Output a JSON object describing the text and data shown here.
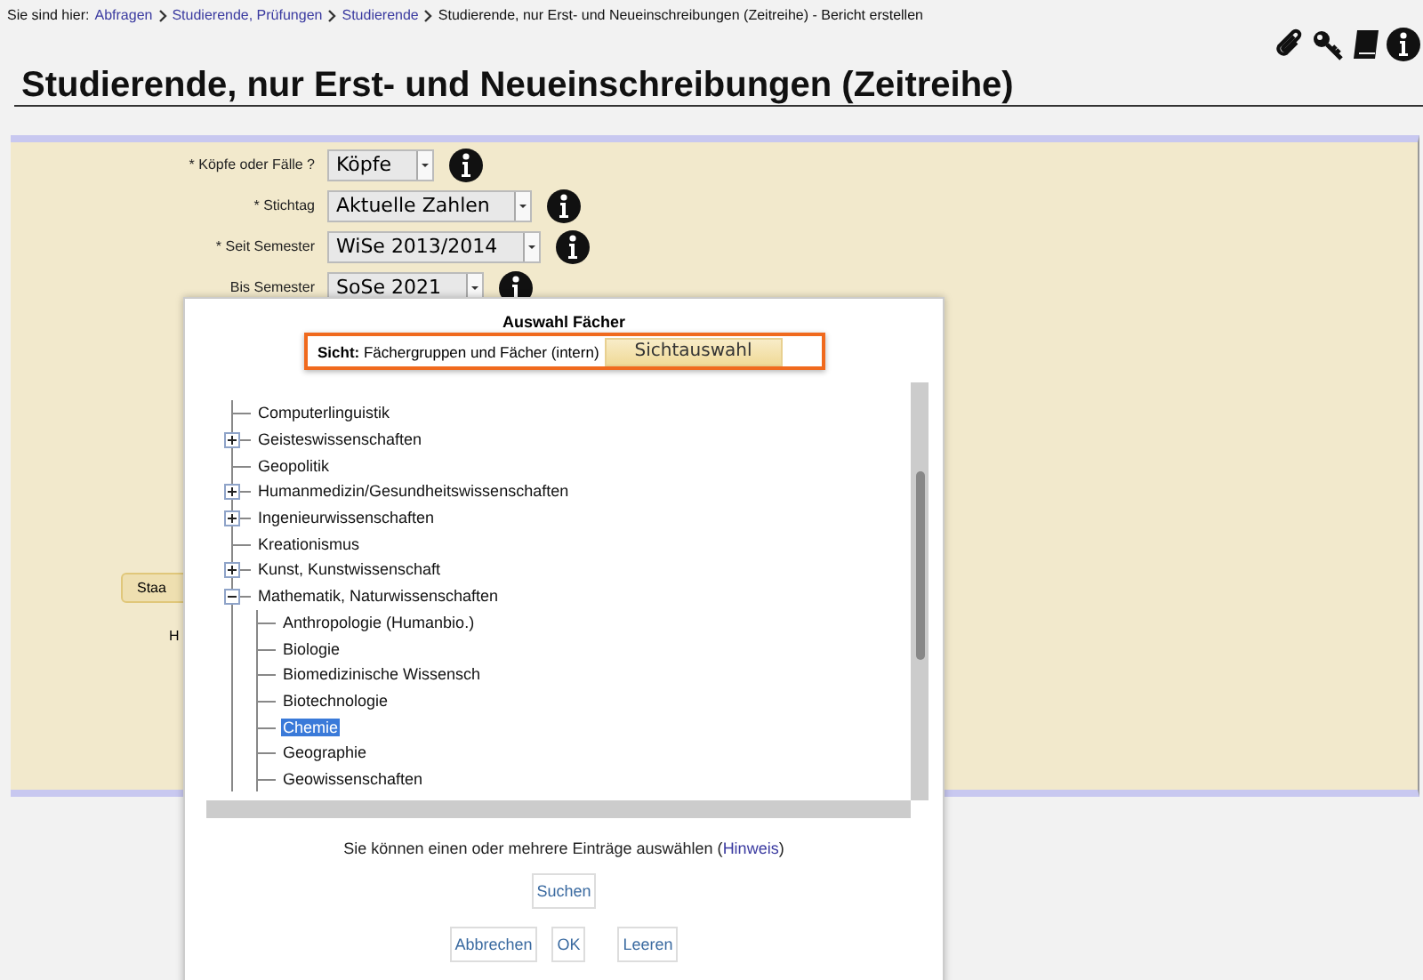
{
  "breadcrumb": {
    "prefix": "Sie sind hier:",
    "links": [
      "Abfragen",
      "Studierende, Prüfungen",
      "Studierende"
    ],
    "current": "Studierende, nur Erst- und Neueinschreibungen (Zeitreihe) - Bericht erstellen"
  },
  "title": "Studierende, nur Erst- und Neueinschreibungen (Zeitreihe)",
  "form": {
    "fields": [
      {
        "label": "* Köpfe oder Fälle ?",
        "value": "Köpfe"
      },
      {
        "label": "* Stichtag",
        "value": "Aktuelle Zahlen"
      },
      {
        "label": "* Seit Semester",
        "value": "WiSe 2013/2014"
      },
      {
        "label": "Bis Semester",
        "value": "SoSe 2021"
      }
    ],
    "button": "Staa",
    "hint": "H"
  },
  "dialog": {
    "title": "Auswahl Fächer",
    "view_label": "Sicht:",
    "view_value": "Fächergruppen und Fächer (intern)",
    "view_button": "Sichtauswahl",
    "tree": [
      {
        "label": "Computerlinguistik",
        "kind": "leaf",
        "selected": false
      },
      {
        "label": "Geisteswissenschaften",
        "kind": "folder",
        "expanded": false,
        "selected": false
      },
      {
        "label": "Geopolitik",
        "kind": "leaf",
        "selected": false
      },
      {
        "label": "Humanmedizin/Gesundheitswissenschaften",
        "kind": "folder",
        "expanded": false,
        "selected": false
      },
      {
        "label": "Ingenieurwissenschaften",
        "kind": "folder",
        "expanded": false,
        "selected": false
      },
      {
        "label": "Kreationismus",
        "kind": "leaf",
        "selected": false
      },
      {
        "label": "Kunst, Kunstwissenschaft",
        "kind": "folder",
        "expanded": false,
        "selected": false
      },
      {
        "label": "Mathematik, Naturwissenschaften",
        "kind": "folder",
        "expanded": true,
        "selected": false,
        "children": [
          {
            "label": "Anthropologie (Humanbio.)",
            "kind": "leaf",
            "selected": false
          },
          {
            "label": "Biologie",
            "kind": "leaf",
            "selected": false
          },
          {
            "label": "Biomedizinische Wissensch",
            "kind": "leaf",
            "selected": false
          },
          {
            "label": "Biotechnologie",
            "kind": "leaf",
            "selected": false
          },
          {
            "label": "Chemie",
            "kind": "leaf",
            "selected": true
          },
          {
            "label": "Geographie",
            "kind": "leaf",
            "selected": false
          },
          {
            "label": "Geowissenschaften",
            "kind": "leaf",
            "selected": false
          }
        ]
      }
    ],
    "note": "Sie können einen oder mehrere Einträge auswählen (",
    "note_link": "Hinweis",
    "note_end": ")",
    "search_button": "Suchen",
    "buttons": [
      "Abbrechen",
      "OK",
      "Leeren"
    ]
  }
}
